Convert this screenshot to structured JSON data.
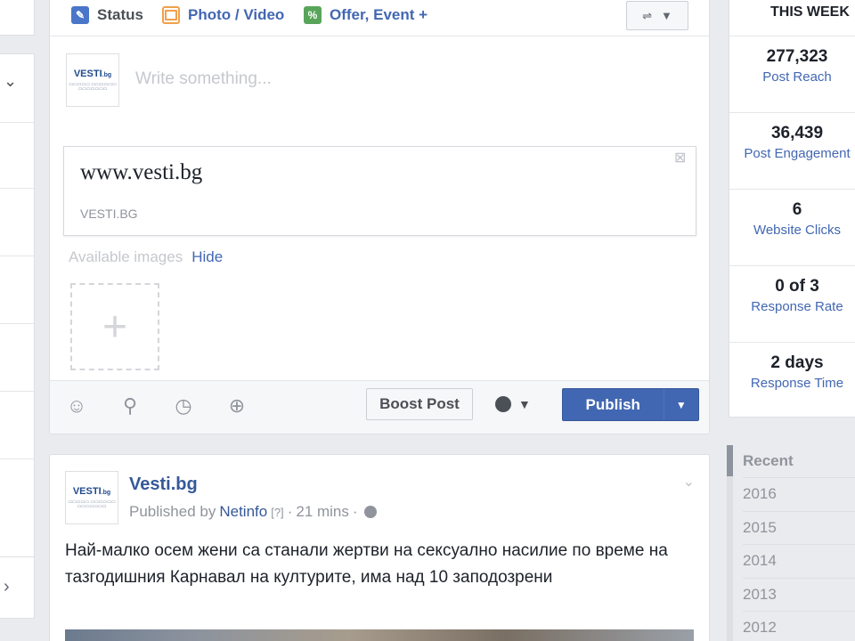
{
  "composer": {
    "tabs": [
      {
        "label": "Status"
      },
      {
        "label": "Photo / Video"
      },
      {
        "label": "Offer, Event +"
      }
    ],
    "write_placeholder": "Write something...",
    "page_logo": "VESTI",
    "page_logo_suffix": ".bg",
    "link_preview": {
      "title": "www.vesti.bg",
      "domain": "VESTI.BG"
    },
    "available_images_label": "Available images",
    "hide_label": "Hide",
    "boost_label": "Boost Post",
    "publish_label": "Publish"
  },
  "post": {
    "page_name": "Vesti.bg",
    "published_by_prefix": "Published by",
    "publisher": "Netinfo",
    "help_marker": "[?]",
    "separator": "·",
    "time": "21 mins",
    "text": "Най-малко осем жени са станали жертви на сексуално насилие по време на тазгодишния Карнавал на културите, има над 10 заподозрени"
  },
  "insights": {
    "header": "THIS WEEK",
    "stats": [
      {
        "value": "277,323",
        "label": "Post Reach"
      },
      {
        "value": "36,439",
        "label": "Post Engagement"
      },
      {
        "value": "6",
        "label": "Website Clicks"
      },
      {
        "value": "0 of 3",
        "label": "Response Rate"
      },
      {
        "value": "2 days",
        "label": "Response Time"
      }
    ]
  },
  "timeline_years": [
    "Recent",
    "2016",
    "2015",
    "2014",
    "2013",
    "2012"
  ],
  "colors": {
    "accent": "#4267b2",
    "background": "#e9ebee",
    "link": "#365899"
  }
}
